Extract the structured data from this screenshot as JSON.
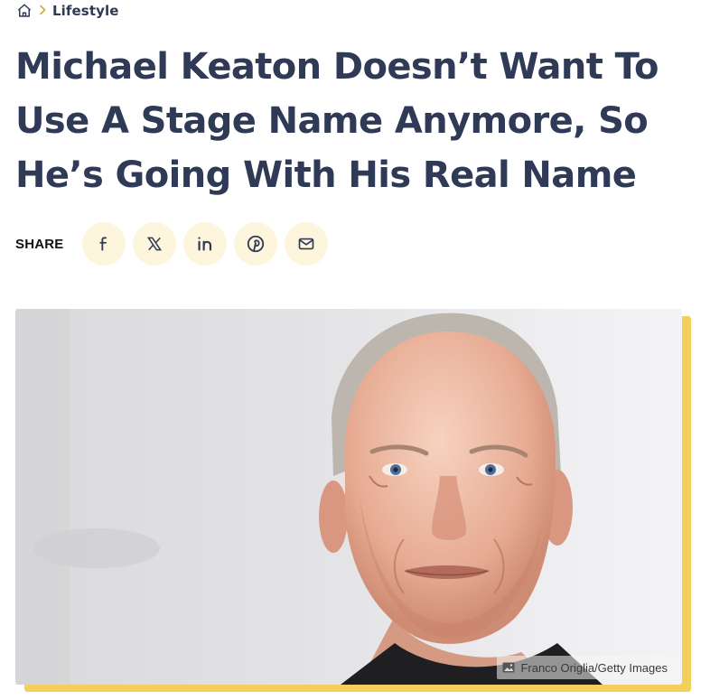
{
  "breadcrumb": {
    "home_icon": "home-icon",
    "separator_icon": "chevron-right-icon",
    "category": "Lifestyle"
  },
  "article": {
    "headline": "Michael Keaton Doesn’t Want To Use A Stage Name Anymore, So He’s Going With His Real Name"
  },
  "share": {
    "label": "SHARE",
    "buttons": [
      {
        "icon": "facebook-icon"
      },
      {
        "icon": "x-icon"
      },
      {
        "icon": "linkedin-icon"
      },
      {
        "icon": "pinterest-icon"
      },
      {
        "icon": "email-icon"
      }
    ]
  },
  "hero": {
    "credit_icon": "image-icon",
    "credit": "Franco Origlia/Getty Images"
  },
  "colors": {
    "headline": "#2f3a57",
    "share_button_bg": "#fdf6dc",
    "accent": "#f3cf5b",
    "breadcrumb_separator": "#d4a93a"
  }
}
